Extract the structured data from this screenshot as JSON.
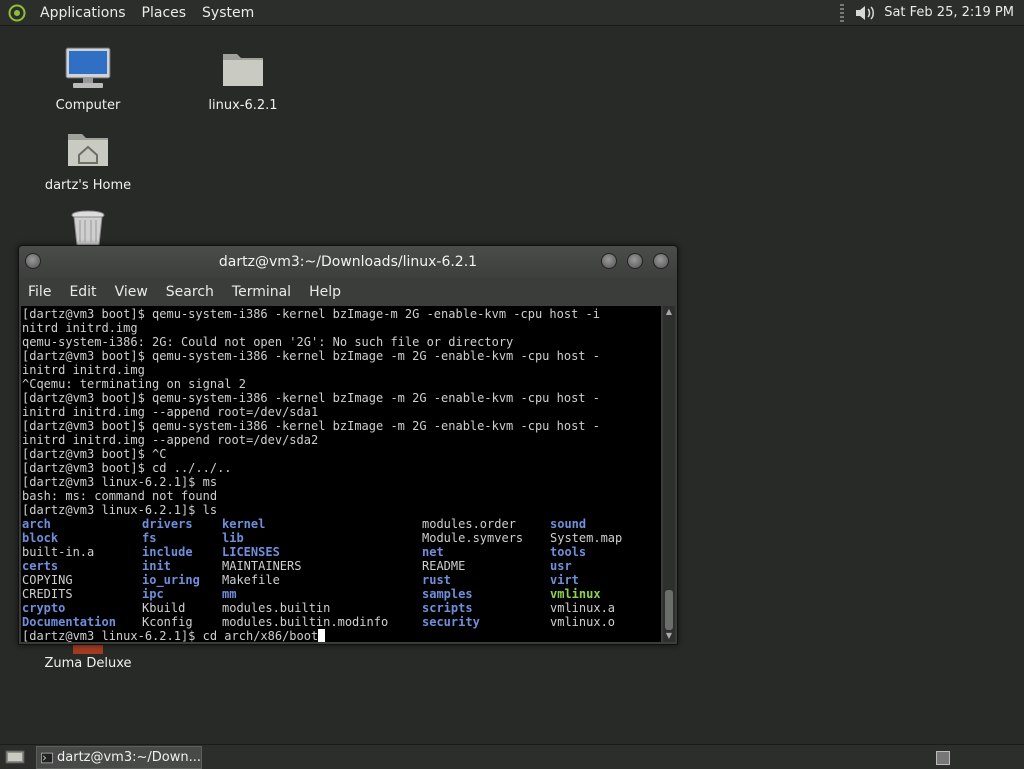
{
  "top_panel": {
    "menus": [
      "Applications",
      "Places",
      "System"
    ],
    "clock": "Sat Feb 25,  2:19 PM"
  },
  "desktop": {
    "icons": [
      {
        "label": "Computer"
      },
      {
        "label": "linux-6.2.1"
      },
      {
        "label": "dartz's Home"
      },
      {
        "label": "Zuma Deluxe"
      }
    ]
  },
  "window": {
    "title": "dartz@vm3:~/Downloads/linux-6.2.1",
    "menus": [
      "File",
      "Edit",
      "View",
      "Search",
      "Terminal",
      "Help"
    ]
  },
  "terminal": {
    "lines": [
      "[dartz@vm3 boot]$ qemu-system-i386 -kernel bzImage-m 2G -enable-kvm -cpu host -i",
      "nitrd initrd.img",
      "qemu-system-i386: 2G: Could not open '2G': No such file or directory",
      "[dartz@vm3 boot]$ qemu-system-i386 -kernel bzImage -m 2G -enable-kvm -cpu host -",
      "initrd initrd.img",
      "^Cqemu: terminating on signal 2",
      "[dartz@vm3 boot]$ qemu-system-i386 -kernel bzImage -m 2G -enable-kvm -cpu host -",
      "initrd initrd.img --append root=/dev/sda1",
      "[dartz@vm3 boot]$ qemu-system-i386 -kernel bzImage -m 2G -enable-kvm -cpu host -",
      "initrd initrd.img --append root=/dev/sda2",
      "[dartz@vm3 boot]$ ^C",
      "[dartz@vm3 boot]$ cd ../../..",
      "[dartz@vm3 linux-6.2.1]$ ms",
      "bash: ms: command not found",
      "[dartz@vm3 linux-6.2.1]$ ls"
    ],
    "ls_rows": [
      [
        {
          "t": "arch",
          "c": "dir"
        },
        {
          "t": "drivers",
          "c": "dir"
        },
        {
          "t": "kernel",
          "c": "dir"
        },
        {
          "t": "modules.order",
          "c": ""
        },
        {
          "t": "sound",
          "c": "dir"
        }
      ],
      [
        {
          "t": "block",
          "c": "dir"
        },
        {
          "t": "fs",
          "c": "dir"
        },
        {
          "t": "lib",
          "c": "dir"
        },
        {
          "t": "Module.symvers",
          "c": ""
        },
        {
          "t": "System.map",
          "c": ""
        }
      ],
      [
        {
          "t": "built-in.a",
          "c": ""
        },
        {
          "t": "include",
          "c": "dir"
        },
        {
          "t": "LICENSES",
          "c": "dir"
        },
        {
          "t": "net",
          "c": "dir"
        },
        {
          "t": "tools",
          "c": "dir"
        }
      ],
      [
        {
          "t": "certs",
          "c": "dir"
        },
        {
          "t": "init",
          "c": "dir"
        },
        {
          "t": "MAINTAINERS",
          "c": ""
        },
        {
          "t": "README",
          "c": ""
        },
        {
          "t": "usr",
          "c": "dir"
        }
      ],
      [
        {
          "t": "COPYING",
          "c": ""
        },
        {
          "t": "io_uring",
          "c": "dir"
        },
        {
          "t": "Makefile",
          "c": ""
        },
        {
          "t": "rust",
          "c": "dir"
        },
        {
          "t": "virt",
          "c": "dir"
        }
      ],
      [
        {
          "t": "CREDITS",
          "c": ""
        },
        {
          "t": "ipc",
          "c": "dir"
        },
        {
          "t": "mm",
          "c": "dir"
        },
        {
          "t": "samples",
          "c": "dir"
        },
        {
          "t": "vmlinux",
          "c": "exe"
        }
      ],
      [
        {
          "t": "crypto",
          "c": "dir"
        },
        {
          "t": "Kbuild",
          "c": ""
        },
        {
          "t": "modules.builtin",
          "c": ""
        },
        {
          "t": "scripts",
          "c": "dir"
        },
        {
          "t": "vmlinux.a",
          "c": ""
        }
      ],
      [
        {
          "t": "Documentation",
          "c": "dir"
        },
        {
          "t": "Kconfig",
          "c": ""
        },
        {
          "t": "modules.builtin.modinfo",
          "c": ""
        },
        {
          "t": "security",
          "c": "dir"
        },
        {
          "t": "vmlinux.o",
          "c": ""
        }
      ]
    ],
    "prompt_line": "[dartz@vm3 linux-6.2.1]$ cd arch/x86/boot"
  },
  "taskbar": {
    "task_label": "dartz@vm3:~/Down..."
  },
  "colors": {
    "dir": "#6f8fdc",
    "exe": "#8fd24a"
  }
}
